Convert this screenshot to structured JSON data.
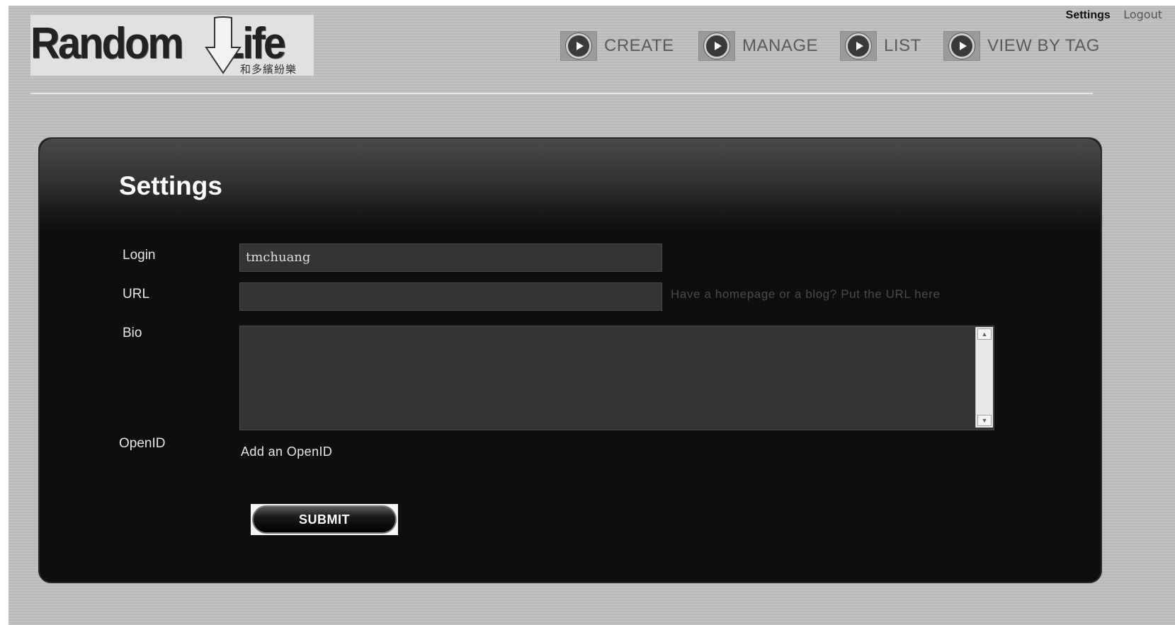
{
  "brand": {
    "logo_text": "RandomLife",
    "logo_subtitle": "和多繽紛樂"
  },
  "top_links": {
    "settings": "Settings",
    "logout": "Logout"
  },
  "nav": {
    "items": [
      {
        "label": "CREATE",
        "icon": "play-icon"
      },
      {
        "label": "MANAGE",
        "icon": "play-icon"
      },
      {
        "label": "LIST",
        "icon": "play-icon"
      },
      {
        "label": "VIEW BY TAG",
        "icon": "play-icon"
      }
    ]
  },
  "panel": {
    "title": "Settings",
    "form": {
      "login_label": "Login",
      "login_value": "tmchuang",
      "url_label": "URL",
      "url_value": "",
      "url_hint": "Have a homepage or a blog? Put the URL here",
      "bio_label": "Bio",
      "bio_value": "",
      "openid_label": "OpenID",
      "openid_link": "Add an OpenID",
      "submit_label": "SUBMIT"
    }
  },
  "colors": {
    "page_bg": "#bfbfbf",
    "panel_bg": "#0d0f0d",
    "field_bg": "#333533",
    "nav_text": "#5a5a5a"
  }
}
